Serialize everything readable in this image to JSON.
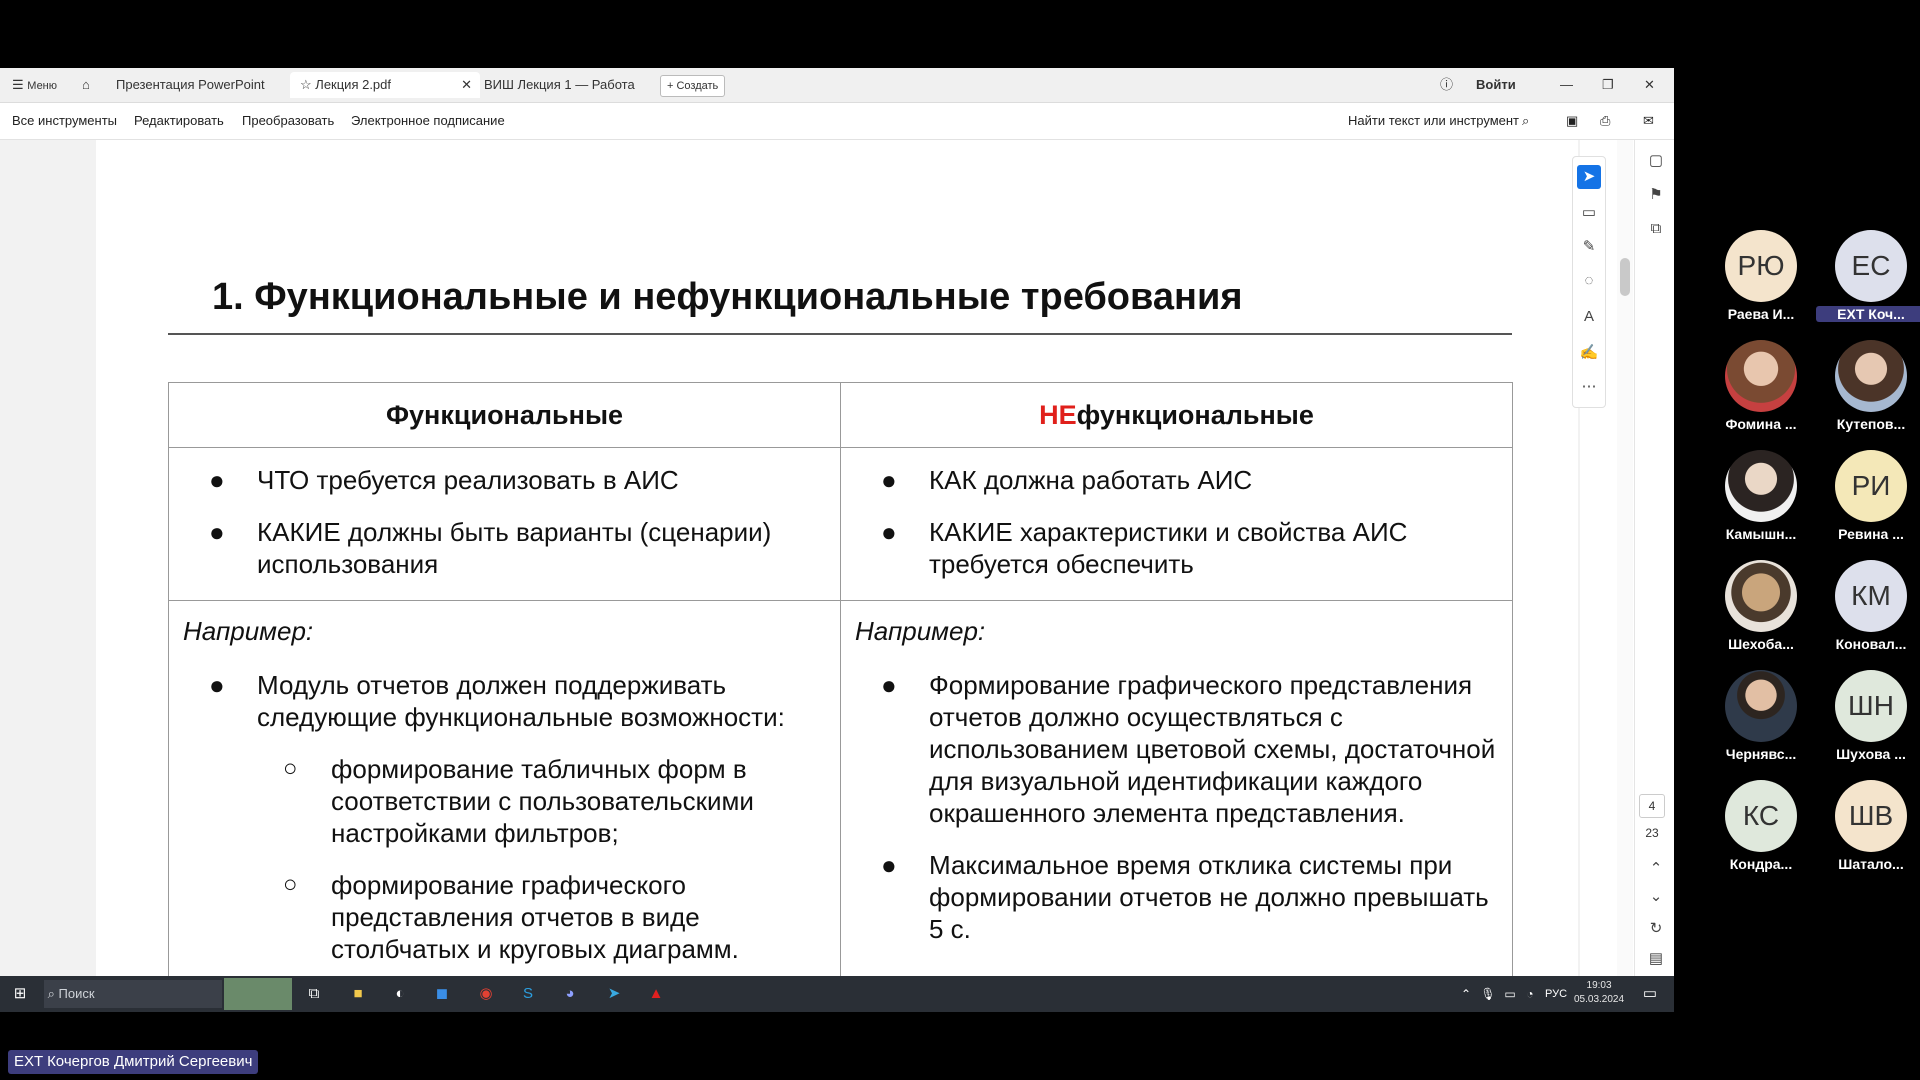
{
  "app": {
    "tabs": [
      {
        "label": "Меню"
      },
      {
        "label": "Презентация PowerPoint"
      },
      {
        "label": "Лекция 2.pdf"
      },
      {
        "label": "ВИШ Лекция 1 — Работа"
      }
    ],
    "create_label": "+ Создать",
    "signin_label": "Войти",
    "toolbar": {
      "all_tools": "Все инструменты",
      "edit": "Редактировать",
      "convert": "Преобразовать",
      "esign": "Электронное подписание",
      "search_placeholder": "Найти текст или инструмент"
    },
    "page_indicator": {
      "current": "4",
      "total": "23"
    }
  },
  "slide": {
    "title": "1.  Функциональные и нефункциональные требования",
    "col1_header": "Функциональные",
    "col2_header_ne": "НЕ",
    "col2_header_rest": "функциональные",
    "col1_bullets": [
      "ЧТО требуется реализовать в АИС",
      "КАКИЕ должны быть варианты (сценарии) использования"
    ],
    "col2_bullets": [
      "КАК должна работать АИС",
      "КАКИЕ характеристики и свойства АИС требуется обеспечить"
    ],
    "example_label": "Например:",
    "col1_example_bullet": "Модуль отчетов должен поддерживать следующие функциональные возможности:",
    "col1_sub_bullets": [
      "формирование табличных форм в соответствии с пользовательскими настройками фильтров;",
      "формирование графического представления отчетов в виде столбчатых и круговых диаграмм."
    ],
    "col2_example_bullets": [
      "Формирование графического представления отчетов должно осуществляться с использованием цветовой схемы, достаточной для визуальной идентификации каждого окрашенного элемента представления.",
      "Максимальное время отклика системы при формировании отчетов не должно превышать 5 с."
    ],
    "page_number": "4"
  },
  "taskbar": {
    "search_placeholder": "Поиск",
    "language": "РУС",
    "time": "19:03",
    "date": "05.03.2024"
  },
  "participants": [
    {
      "initials": "РЮ",
      "name": "Раева И...",
      "color": "#f4e4cc"
    },
    {
      "initials": "ЕС",
      "name": "EXT Коч...",
      "color": "#dde0ec"
    },
    {
      "initials": "",
      "name": "Фомина ...",
      "color": "#c79a82"
    },
    {
      "initials": "",
      "name": "Кутепов...",
      "color": "#a98f7c"
    },
    {
      "initials": "",
      "name": "Камышн...",
      "color": "#d8d2cc"
    },
    {
      "initials": "РИ",
      "name": "Ревина ...",
      "color": "#f4e8b8"
    },
    {
      "initials": "",
      "name": "Шехоба...",
      "color": "#c8b08c"
    },
    {
      "initials": "КМ",
      "name": "Коновал...",
      "color": "#dde0ec"
    },
    {
      "initials": "",
      "name": "Чернявс...",
      "color": "#9aa4b0"
    },
    {
      "initials": "ШН",
      "name": "Шухова ...",
      "color": "#dfe8dc"
    },
    {
      "initials": "КС",
      "name": "Кондра...",
      "color": "#dfe8dc"
    },
    {
      "initials": "ШВ",
      "name": "Шатало...",
      "color": "#f4e4cc"
    }
  ],
  "presenter_label": "EXT Кочергов Дмитрий Сергеевич",
  "colors": {
    "accent": "#1473e6",
    "ne_red": "#e0201b",
    "label_bg": "#3d3d7d"
  }
}
